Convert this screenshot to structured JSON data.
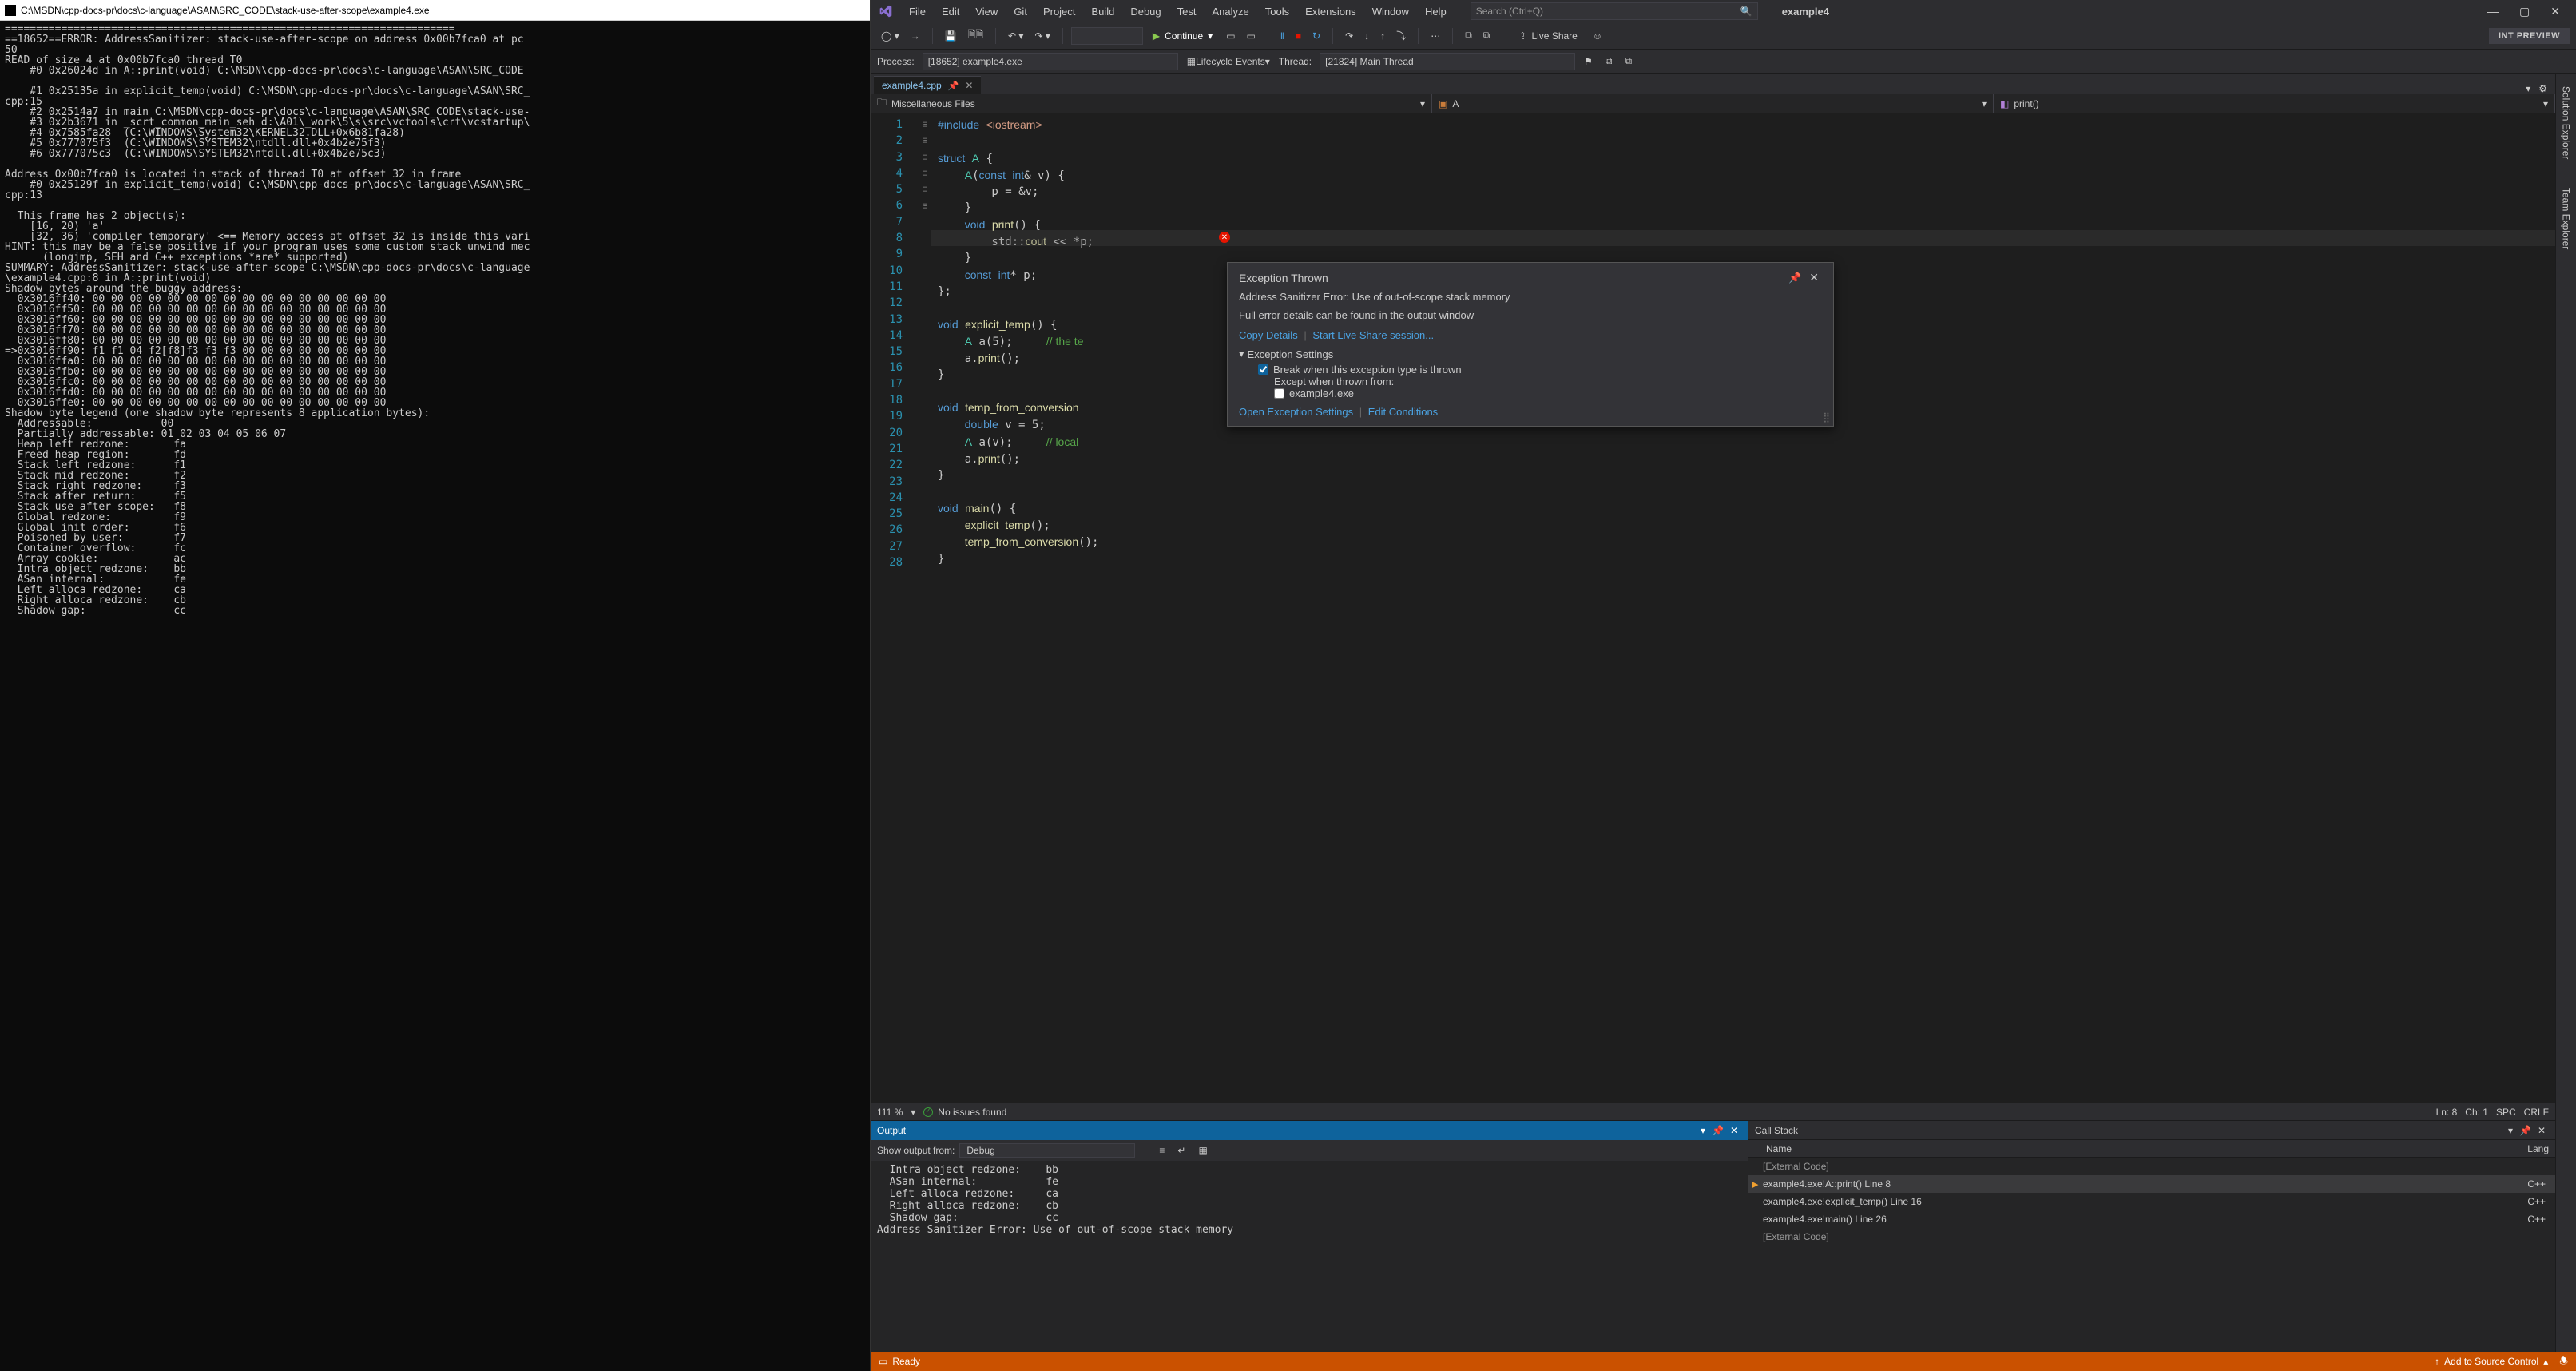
{
  "console": {
    "title": "C:\\MSDN\\cpp-docs-pr\\docs\\c-language\\ASAN\\SRC_CODE\\stack-use-after-scope\\example4.exe",
    "text": "========================================================================\n==18652==ERROR: AddressSanitizer: stack-use-after-scope on address 0x00b7fca0 at pc\n50\nREAD of size 4 at 0x00b7fca0 thread T0\n    #0 0x26024d in A::print(void) C:\\MSDN\\cpp-docs-pr\\docs\\c-language\\ASAN\\SRC_CODE\n\n    #1 0x25135a in explicit_temp(void) C:\\MSDN\\cpp-docs-pr\\docs\\c-language\\ASAN\\SRC_\ncpp:15\n    #2 0x2514a7 in main C:\\MSDN\\cpp-docs-pr\\docs\\c-language\\ASAN\\SRC_CODE\\stack-use-\n    #3 0x2b3671 in _scrt_common_main_seh d:\\A01\\_work\\5\\s\\src\\vctools\\crt\\vcstartup\\\n    #4 0x7585fa28  (C:\\WINDOWS\\System32\\KERNEL32.DLL+0x6b81fa28)\n    #5 0x777075f3  (C:\\WINDOWS\\SYSTEM32\\ntdll.dll+0x4b2e75f3)\n    #6 0x777075c3  (C:\\WINDOWS\\SYSTEM32\\ntdll.dll+0x4b2e75c3)\n\nAddress 0x00b7fca0 is located in stack of thread T0 at offset 32 in frame\n    #0 0x25129f in explicit_temp(void) C:\\MSDN\\cpp-docs-pr\\docs\\c-language\\ASAN\\SRC_\ncpp:13\n\n  This frame has 2 object(s):\n    [16, 20) 'a'\n    [32, 36) 'compiler temporary' <== Memory access at offset 32 is inside this vari\nHINT: this may be a false positive if your program uses some custom stack unwind mec\n      (longjmp, SEH and C++ exceptions *are* supported)\nSUMMARY: AddressSanitizer: stack-use-after-scope C:\\MSDN\\cpp-docs-pr\\docs\\c-language\n\\example4.cpp:8 in A::print(void)\nShadow bytes around the buggy address:\n  0x3016ff40: 00 00 00 00 00 00 00 00 00 00 00 00 00 00 00 00\n  0x3016ff50: 00 00 00 00 00 00 00 00 00 00 00 00 00 00 00 00\n  0x3016ff60: 00 00 00 00 00 00 00 00 00 00 00 00 00 00 00 00\n  0x3016ff70: 00 00 00 00 00 00 00 00 00 00 00 00 00 00 00 00\n  0x3016ff80: 00 00 00 00 00 00 00 00 00 00 00 00 00 00 00 00\n=>0x3016ff90: f1 f1 04 f2[f8]f3 f3 f3 00 00 00 00 00 00 00 00\n  0x3016ffa0: 00 00 00 00 00 00 00 00 00 00 00 00 00 00 00 00\n  0x3016ffb0: 00 00 00 00 00 00 00 00 00 00 00 00 00 00 00 00\n  0x3016ffc0: 00 00 00 00 00 00 00 00 00 00 00 00 00 00 00 00\n  0x3016ffd0: 00 00 00 00 00 00 00 00 00 00 00 00 00 00 00 00\n  0x3016ffe0: 00 00 00 00 00 00 00 00 00 00 00 00 00 00 00 00\nShadow byte legend (one shadow byte represents 8 application bytes):\n  Addressable:           00\n  Partially addressable: 01 02 03 04 05 06 07\n  Heap left redzone:       fa\n  Freed heap region:       fd\n  Stack left redzone:      f1\n  Stack mid redzone:       f2\n  Stack right redzone:     f3\n  Stack after return:      f5\n  Stack use after scope:   f8\n  Global redzone:          f9\n  Global init order:       f6\n  Poisoned by user:        f7\n  Container overflow:      fc\n  Array cookie:            ac\n  Intra object redzone:    bb\n  ASan internal:           fe\n  Left alloca redzone:     ca\n  Right alloca redzone:    cb\n  Shadow gap:              cc"
  },
  "vs": {
    "menu": [
      "File",
      "Edit",
      "View",
      "Git",
      "Project",
      "Build",
      "Debug",
      "Test",
      "Analyze",
      "Tools",
      "Extensions",
      "Window",
      "Help"
    ],
    "search_placeholder": "Search (Ctrl+Q)",
    "solution_name": "example4",
    "toolbar": {
      "continue": "Continue",
      "int_preview": "INT PREVIEW",
      "live_share": "Live Share"
    },
    "toolbar2": {
      "process_label": "Process:",
      "process_value": "[18652] example4.exe",
      "lifecycle": "Lifecycle Events",
      "thread_label": "Thread:",
      "thread_value": "[21824] Main Thread"
    },
    "tabs": {
      "active": "example4.cpp"
    },
    "nav": {
      "scope": "Miscellaneous Files",
      "class": "A",
      "member": "print()"
    },
    "code": {
      "lines": [
        "#include <iostream>",
        "",
        "struct A {",
        "    A(const int& v) {",
        "        p = &v;",
        "    }",
        "    void print() {",
        "        std::cout << *p;",
        "    }",
        "    const int* p;",
        "};",
        "",
        "void explicit_temp() {",
        "    A a(5);     // the te",
        "    a.print();",
        "}",
        "",
        "void temp_from_conversion",
        "    double v = 5;",
        "    A a(v);     // local ",
        "    a.print();",
        "}",
        "",
        "void main() {",
        "    explicit_temp();",
        "    temp_from_conversion();",
        "}",
        ""
      ]
    },
    "editor_status": {
      "zoom": "111 %",
      "issues": "No issues found",
      "ln": "Ln: 8",
      "ch": "Ch: 1",
      "spc": "SPC",
      "crlf": "CRLF"
    },
    "exception": {
      "title": "Exception Thrown",
      "message": "Address Sanitizer Error: Use of out-of-scope stack memory",
      "detail": "Full error details can be found in the output window",
      "copy": "Copy Details",
      "liveshare": "Start Live Share session...",
      "settings_header": "Exception Settings",
      "break_when": "Break when this exception type is thrown",
      "except_from": "Except when thrown from:",
      "except_item": "example4.exe",
      "open_settings": "Open Exception Settings",
      "edit_cond": "Edit Conditions"
    },
    "output": {
      "title": "Output",
      "show_from": "Show output from:",
      "source": "Debug",
      "text": "  Intra object redzone:    bb\n  ASan internal:           fe\n  Left alloca redzone:     ca\n  Right alloca redzone:    cb\n  Shadow gap:              cc\nAddress Sanitizer Error: Use of out-of-scope stack memory"
    },
    "callstack": {
      "title": "Call Stack",
      "cols": {
        "name": "Name",
        "lang": "Lang"
      },
      "rows": [
        {
          "name": "[External Code]",
          "lang": "",
          "ext": true
        },
        {
          "name": "example4.exe!A::print() Line 8",
          "lang": "C++",
          "current": true
        },
        {
          "name": "example4.exe!explicit_temp() Line 16",
          "lang": "C++"
        },
        {
          "name": "example4.exe!main() Line 26",
          "lang": "C++"
        },
        {
          "name": "[External Code]",
          "lang": "",
          "ext": true
        }
      ]
    },
    "right_dock": [
      "Solution Explorer",
      "Team Explorer"
    ],
    "statusbar": {
      "ready": "Ready",
      "add_src": "Add to Source Control"
    }
  }
}
